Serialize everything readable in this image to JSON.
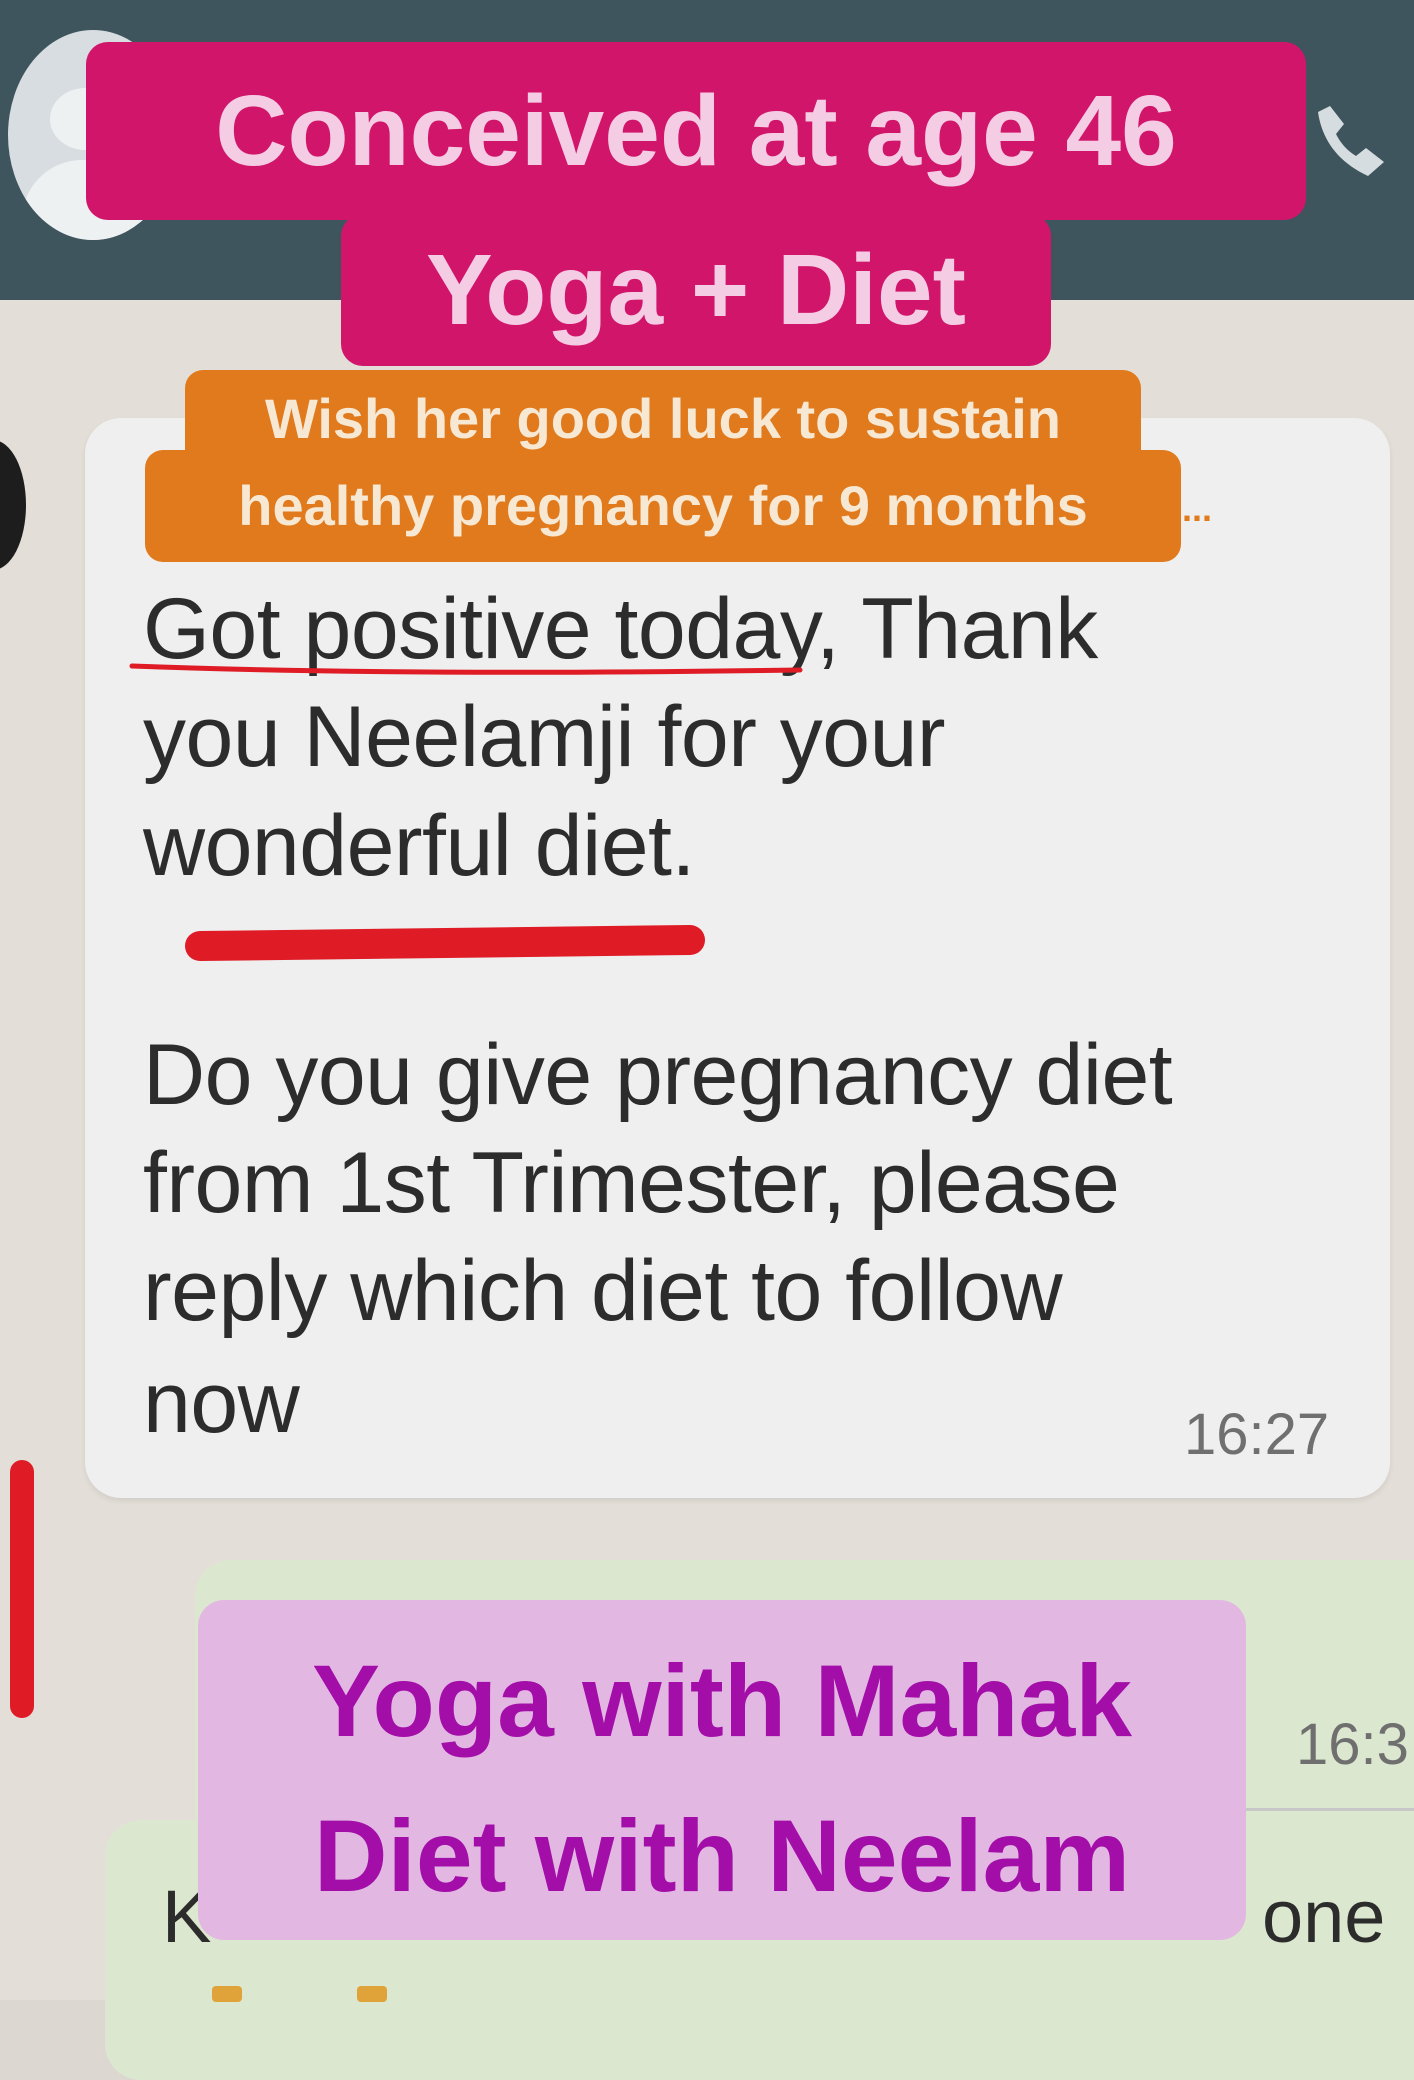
{
  "overlays": {
    "title_line1": "Conceived at age 46",
    "title_line2": "Yoga + Diet",
    "wish_line1": "Wish her good luck to sustain",
    "wish_line2": "healthy pregnancy for 9 months",
    "promo_line1": "Yoga with Mahak",
    "promo_line2": "Diet with Neelam"
  },
  "received_message": {
    "sender_ellipsis": "...",
    "lines": [
      "Got positive today, Thank",
      "you  Neelamji for your",
      "wonderful diet.",
      "Do you give pregnancy diet",
      "from 1st Trimester, please",
      "reply which diet to follow",
      "now"
    ],
    "time": "16:27"
  },
  "sent_message": {
    "time_partial": "16:3",
    "text_start": "K",
    "text_end": "one"
  },
  "colors": {
    "header": "#3f555d",
    "chat_background": "#e3dfd8",
    "received_bubble": "#efefef",
    "sent_bubble": "#dbe8cf",
    "title_caption": "#d1156a",
    "wish_caption": "#e07a1c",
    "promo_caption": "#e2b8e3",
    "promo_text": "#a30ea8",
    "underline": "#df1b25"
  },
  "icons": [
    "avatar-icon",
    "phone-call-icon"
  ]
}
